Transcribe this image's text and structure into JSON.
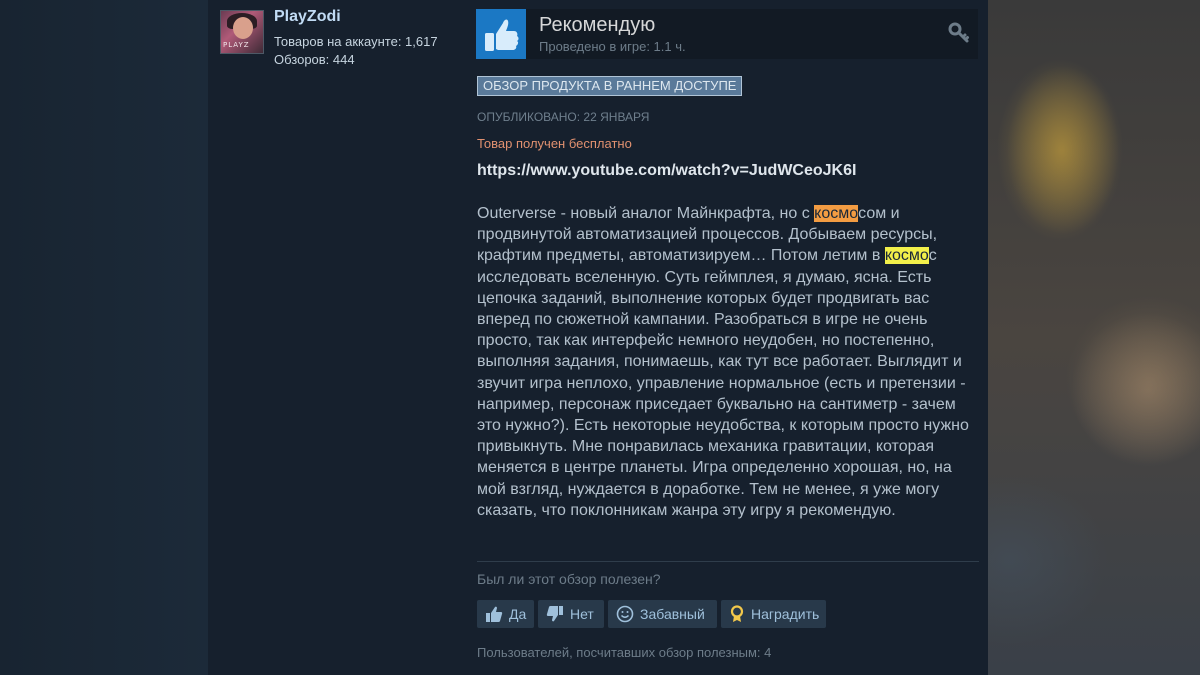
{
  "author": {
    "name": "PlayZodi",
    "products_line": "Товаров на аккаунте: 1,617",
    "reviews_line": "Обзоров: 444"
  },
  "review": {
    "verdict": "Рекомендую",
    "playtime": "Проведено в игре: 1.1 ч.",
    "early_access_badge": "ОБЗОР ПРОДУКТА В РАННЕМ ДОСТУПЕ",
    "posted": "ОПУБЛИКОВАНО: 22 ЯНВАРЯ",
    "free_notice": "Товар получен бесплатно",
    "link": "https://www.youtube.com/watch?v=JudWCeoJK6I",
    "body": {
      "p1": "Outerverse - новый аналог Майнкрафта, но с ",
      "hl1": "космо",
      "p2": "сом и продвинутой автоматизацией процессов. Добываем ресурсы, крафтим предметы, автоматизируем… Потом летим в ",
      "hl2": "космо",
      "p3": "с исследовать вселенную. Суть геймплея, я думаю, ясна. Есть цепочка заданий, выполнение которых будет продвигать вас вперед по сюжетной кампании. Разобраться в игре не очень просто, так как интерфейс немного неудобен, но постепенно, выполняя задания, понимаешь, как тут все работает. Выглядит и звучит игра неплохо, управление нормальное (есть и претензии - например, персонаж приседает буквально на сантиметр - зачем это нужно?). Есть некоторые неудобства, к которым просто нужно привыкнуть. Мне понравилась механика гравитации, которая меняется в центре планеты. Игра определенно хорошая, но, на мой взгляд, нуждается в доработке. Тем не менее, я уже могу сказать, что поклонникам жанра эту игру я рекомендую."
    }
  },
  "feedback": {
    "question": "Был ли этот обзор полезен?",
    "yes": "Да",
    "no": "Нет",
    "funny": "Забавный",
    "award": "Наградить",
    "helpful_count": "Пользователей, посчитавших обзор полезным: 4"
  },
  "colors": {
    "background": "#1b2838",
    "panel": "#16202d",
    "thumb_bg": "#1b78c4",
    "highlight_orange": "#f39c42",
    "highlight_yellow": "#f3f04a",
    "free_notice": "#e19170"
  },
  "icons": {
    "thumb": "thumbs-up-icon",
    "key": "key-icon",
    "yes": "thumbs-up-icon",
    "no": "thumbs-down-icon",
    "funny": "smiley-icon",
    "award": "award-icon"
  }
}
